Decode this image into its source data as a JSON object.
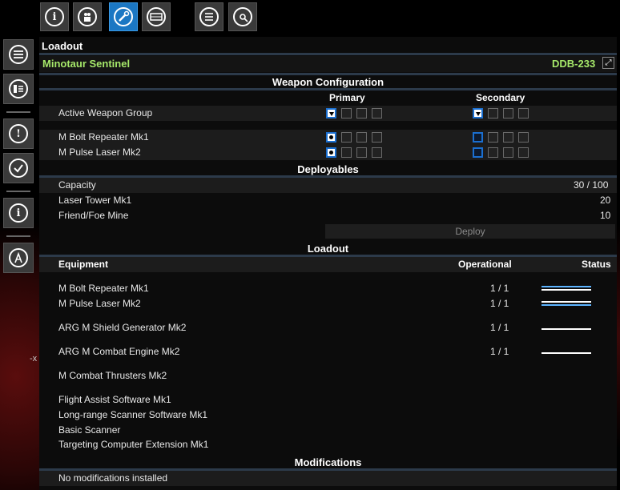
{
  "side_mark": "-x",
  "top_tabs": [
    {
      "icon": "info-icon",
      "active": false
    },
    {
      "icon": "crew-icon",
      "active": false
    },
    {
      "icon": "wrench-icon",
      "active": true
    },
    {
      "icon": "storage-icon",
      "active": false
    },
    {
      "icon": "list-icon",
      "active": false
    },
    {
      "icon": "drone-icon",
      "active": false
    }
  ],
  "left_icons": [
    "menu-icon",
    "ship-info-icon",
    "alert-icon",
    "check-icon",
    "info-icon",
    "compass-icon"
  ],
  "panel": {
    "title": "Loadout",
    "ship_name": "Minotaur Sentinel",
    "ship_id": "DDB-233",
    "expand_glyph": "⤢"
  },
  "weapon_config": {
    "header": "Weapon Configuration",
    "primary_label": "Primary",
    "secondary_label": "Secondary",
    "rows": [
      {
        "label": "Active Weapon Group"
      },
      {
        "label": "M Bolt Repeater Mk1"
      },
      {
        "label": "M Pulse Laser Mk2"
      }
    ]
  },
  "deployables": {
    "header": "Deployables",
    "capacity_label": "Capacity",
    "capacity_value": "30 / 100",
    "items": [
      {
        "name": "Laser Tower Mk1",
        "count": "20"
      },
      {
        "name": "Friend/Foe Mine",
        "count": "10"
      }
    ],
    "deploy_label": "Deploy"
  },
  "loadout": {
    "header": "Loadout",
    "col_equipment": "Equipment",
    "col_operational": "Operational",
    "col_status": "Status",
    "items": [
      {
        "name": "M Bolt Repeater Mk1",
        "operational": "1 / 1",
        "status": "blue"
      },
      {
        "name": "M Pulse Laser Mk2",
        "operational": "1 / 1",
        "status": "blue"
      },
      {
        "name": "ARG M Shield Generator Mk2",
        "operational": "1 / 1",
        "status": "white"
      },
      {
        "name": "ARG M Combat Engine Mk2",
        "operational": "1 / 1",
        "status": "white"
      },
      {
        "name": "M Combat Thrusters Mk2",
        "operational": "",
        "status": "none"
      },
      {
        "name": "Flight Assist Software Mk1",
        "operational": "",
        "status": "none"
      },
      {
        "name": "Long-range Scanner Software Mk1",
        "operational": "",
        "status": "none"
      },
      {
        "name": "Basic Scanner",
        "operational": "",
        "status": "none"
      },
      {
        "name": "Targeting Computer Extension Mk1",
        "operational": "",
        "status": "none"
      }
    ]
  },
  "modifications": {
    "header": "Modifications",
    "text": "No modifications installed"
  },
  "colors": {
    "accent": "#1b77c3",
    "ship_name": "#a6e86a",
    "status_blue": "#5db4ff"
  }
}
